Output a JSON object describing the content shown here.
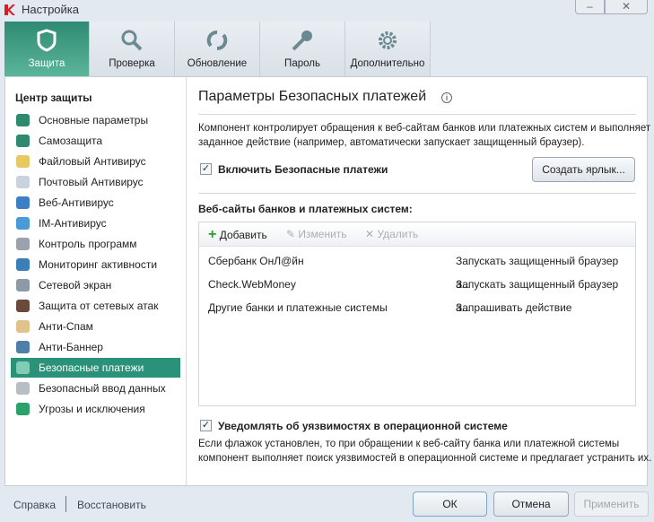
{
  "window": {
    "title": "Настройка"
  },
  "tabs": [
    {
      "label": "Защита",
      "icon": "shield-icon"
    },
    {
      "label": "Проверка",
      "icon": "search-icon"
    },
    {
      "label": "Обновление",
      "icon": "refresh-icon"
    },
    {
      "label": "Пароль",
      "icon": "key-icon"
    },
    {
      "label": "Дополнительно",
      "icon": "gear-icon"
    }
  ],
  "sidebar": {
    "heading": "Центр защиты",
    "items": [
      {
        "label": "Основные параметры",
        "color": "#2e8a6e"
      },
      {
        "label": "Самозащита",
        "color": "#2e8a6e"
      },
      {
        "label": "Файловый Антивирус",
        "color": "#e8c860"
      },
      {
        "label": "Почтовый Антивирус",
        "color": "#c9d3de"
      },
      {
        "label": "Веб-Антивирус",
        "color": "#3c7fc4"
      },
      {
        "label": "IM-Антивирус",
        "color": "#4a9ad8"
      },
      {
        "label": "Контроль программ",
        "color": "#9aa3ad"
      },
      {
        "label": "Мониторинг активности",
        "color": "#3a7fb8"
      },
      {
        "label": "Сетевой экран",
        "color": "#8c9aa5"
      },
      {
        "label": "Защита от сетевых атак",
        "color": "#6a4a3a"
      },
      {
        "label": "Анти-Спам",
        "color": "#e0c38a"
      },
      {
        "label": "Анти-Баннер",
        "color": "#4d7fa8"
      },
      {
        "label": "Безопасные платежи",
        "color": "#7fcdb5"
      },
      {
        "label": "Безопасный ввод данных",
        "color": "#b8bec5"
      },
      {
        "label": "Угрозы и исключения",
        "color": "#2aa26a"
      }
    ],
    "selected": 12
  },
  "main": {
    "title": "Параметры Безопасных платежей",
    "desc1": "Компонент контролирует обращения к веб-сайтам банков или платежных систем и выполняет",
    "desc2": "заданное действие (например, автоматически запускает защищенный браузер).",
    "enable_label": "Включить Безопасные платежи",
    "enable_checked": true,
    "shortcut_button": "Создать ярлык...",
    "list_label": "Веб-сайты банков и платежных систем:",
    "toolbar": {
      "add": "Добавить",
      "edit": "Изменить",
      "delete": "Удалить"
    },
    "rows": [
      {
        "site": "Сбербанк ОнЛ@йн",
        "action": "Запускать защищенный браузер а..."
      },
      {
        "site": "Check.WebMoney",
        "action": "Запускать защищенный браузер а..."
      },
      {
        "site": "Другие банки и платежные системы",
        "action": "Запрашивать действие"
      }
    ],
    "notify_label": "Уведомлять об уязвимостях в операционной системе",
    "notify_checked": true,
    "note1": "Если флажок установлен, то при обращении к веб-сайту банка или платежной системы",
    "note2": "компонент выполняет поиск уязвимостей в операционной системе и предлагает устранить их."
  },
  "footer": {
    "help": "Справка",
    "restore": "Восстановить",
    "ok": "ОК",
    "cancel": "Отмена",
    "apply": "Применить"
  },
  "colors": {
    "accent": "#2b927a"
  }
}
